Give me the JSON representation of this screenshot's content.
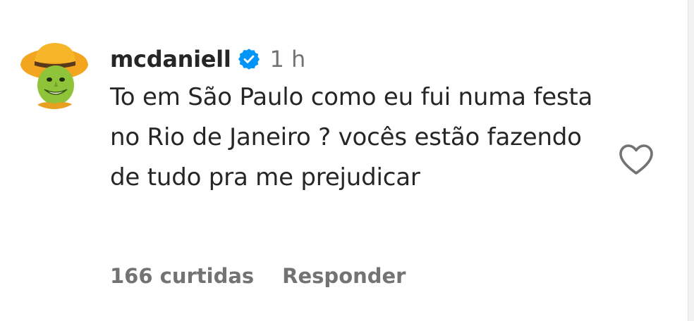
{
  "comment": {
    "username": "mcdaniell",
    "verified": true,
    "verified_icon": "verified-badge-icon",
    "time": "1 h",
    "text": "To em São Paulo como eu fui numa festa no Rio de Janeiro ? vocês estão fazendo de tudo pra me prejudicar",
    "likes": "166 curtidas",
    "reply_label": "Responder",
    "like_icon": "heart-outline-icon"
  },
  "colors": {
    "text": "#262626",
    "secondary": "#737373",
    "verified_blue": "#0095f6",
    "background": "#ffffff"
  }
}
